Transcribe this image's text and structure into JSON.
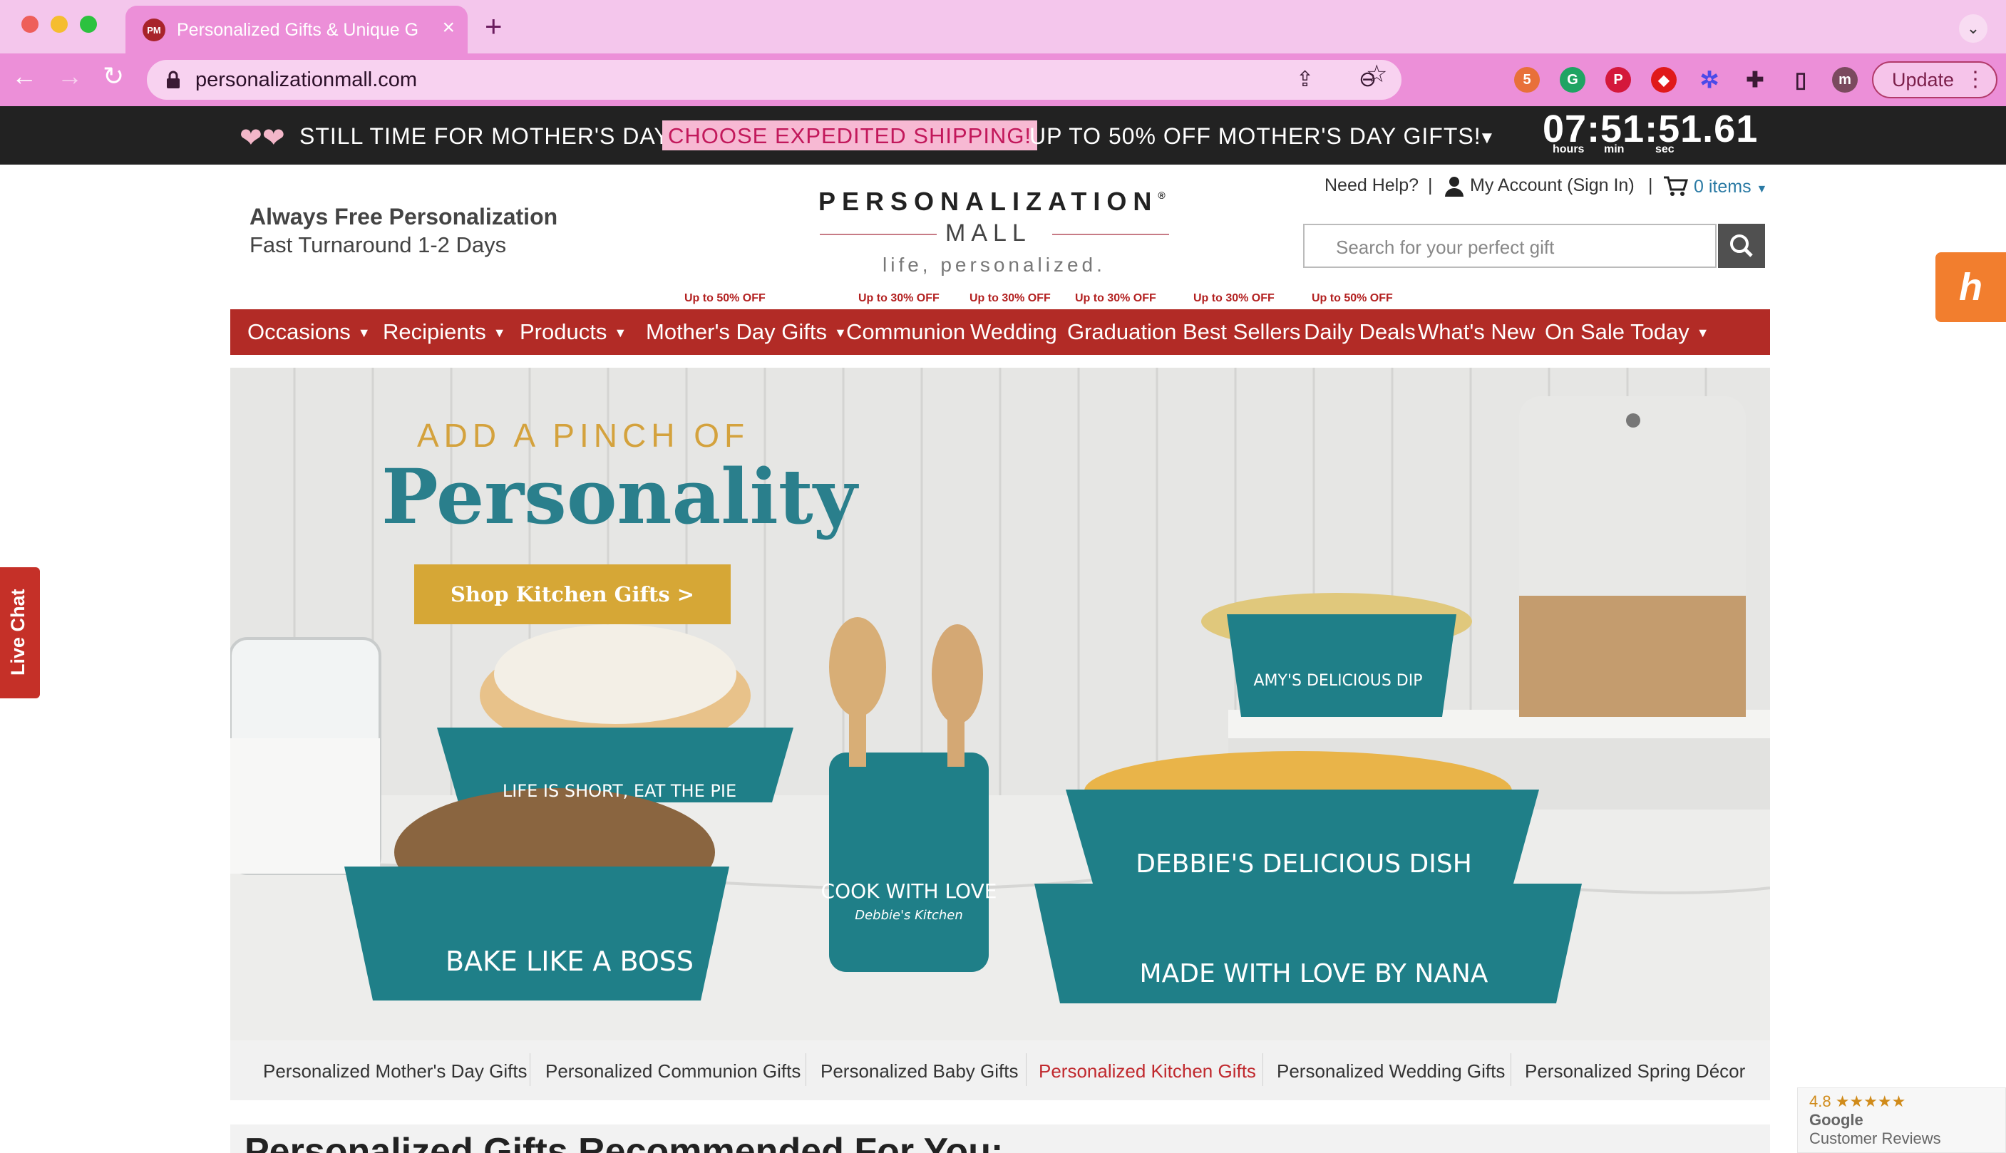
{
  "browser": {
    "tab_title": "Personalized Gifts & Unique Gi",
    "tab_favicon": "PM",
    "url": "personalizationmall.com",
    "update_label": "Update",
    "profile_initial": "m",
    "extension_badge": "5"
  },
  "promo": {
    "text1": "STILL TIME FOR MOTHER'S DAY!",
    "highlight": "CHOOSE EXPEDITED SHIPPING!",
    "text2": "UP TO 50% OFF MOTHER'S DAY GIFTS!",
    "countdown": "07:51:51.61",
    "labels": {
      "hours": "hours",
      "min": "min",
      "sec": "sec"
    }
  },
  "header": {
    "line1": "Always Free Personalization",
    "line2": "Fast Turnaround 1-2 Days",
    "logo_top": "PERSONALIZATION",
    "logo_reg": "®",
    "logo_bottom": "MALL",
    "tagline": "life, personalized.",
    "help": "Need Help?",
    "sep": "|",
    "account": "My Account (Sign In)",
    "cart": "0 items",
    "search_placeholder": "Search for your perfect gift"
  },
  "nav": {
    "badges": [
      "Up to 50% OFF",
      "Up to 30% OFF",
      "Up to 30% OFF",
      "Up to 30% OFF",
      "Up to 30% OFF",
      "Up to 50% OFF"
    ],
    "items": [
      "Occasions",
      "Recipients",
      "Products",
      "Mother's Day Gifts",
      "Communion",
      "Wedding",
      "Graduation",
      "Best Sellers",
      "Daily Deals",
      "What's New",
      "On Sale Today"
    ]
  },
  "hero": {
    "kicker": "ADD A PINCH OF",
    "title": "Personality",
    "cta": "Shop Kitchen Gifts >",
    "dish_texts": [
      "LIFE IS SHORT, EAT THE PIE",
      "BAKE LIKE A BOSS",
      "COOK WITH LOVE",
      "Debbie's Kitchen",
      "AMY'S DELICIOUS DIP",
      "DEBBIE'S DELICIOUS DISH",
      "MADE WITH LOVE BY NANA"
    ]
  },
  "live_chat": "Live Chat",
  "categories": [
    "Personalized Mother's Day Gifts",
    "Personalized Communion Gifts",
    "Personalized Baby Gifts",
    "Personalized Kitchen Gifts",
    "Personalized Wedding Gifts",
    "Personalized Spring Décor"
  ],
  "active_category": "Personalized Kitchen Gifts",
  "recommendations_title": "Personalized Gifts Recommended For You:",
  "google_badge": {
    "rating": "4.8",
    "stars": "★★★★★",
    "brand": "Google",
    "label": "Customer Reviews"
  },
  "colors": {
    "nav_red": "#b22b26",
    "teal": "#2a7f8c",
    "gold": "#d6a736",
    "promo_pink": "#f7b9d3"
  }
}
